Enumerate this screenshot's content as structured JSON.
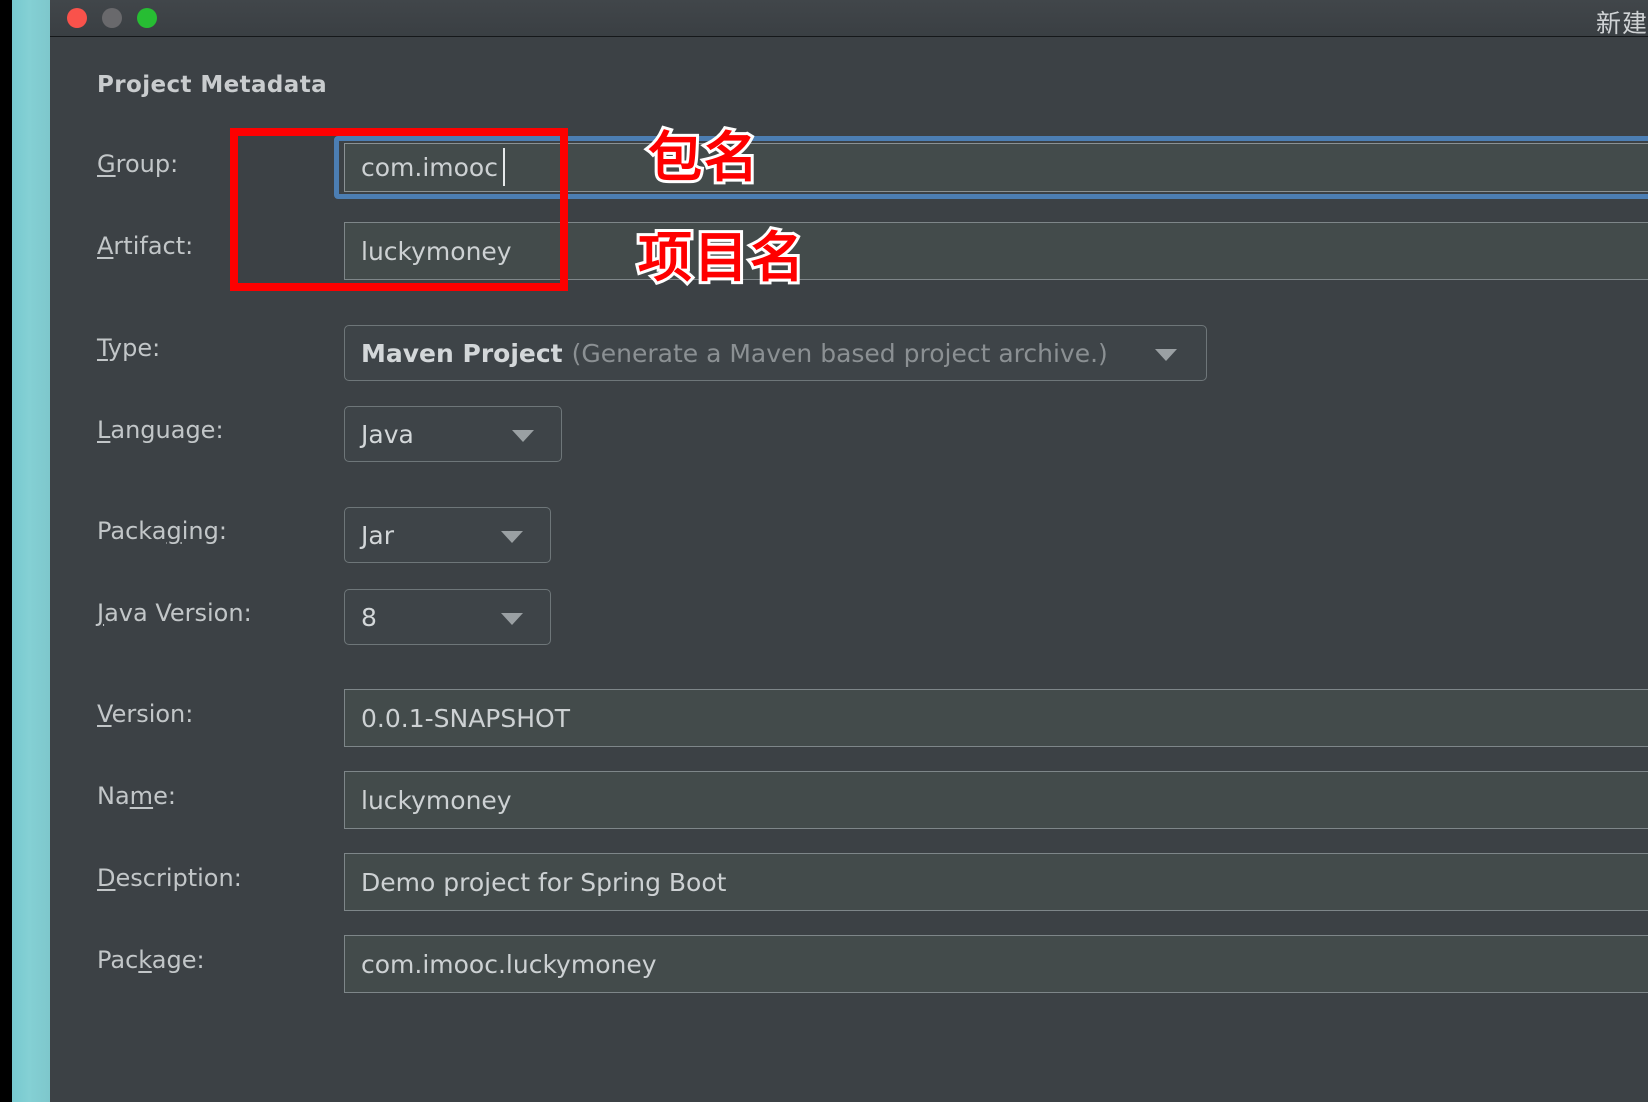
{
  "window": {
    "title": "新建",
    "traffic_lights": [
      "close",
      "minimize",
      "zoom"
    ]
  },
  "section": {
    "heading": "Project Metadata"
  },
  "form": {
    "group": {
      "label_pre": "G",
      "label_post": "roup:",
      "value": "com.imooc",
      "focused": true
    },
    "artifact": {
      "label_pre": "A",
      "label_post": "rtifact:",
      "value": "luckymoney"
    },
    "type": {
      "label_pre": "T",
      "label_post": "ype:",
      "value": "Maven Project",
      "hint": "(Generate a Maven based project archive.)"
    },
    "language": {
      "label_a": "L",
      "label_pre": "",
      "label_post": "anguage:",
      "value": "Java"
    },
    "packaging": {
      "label_a": "Packa",
      "label_b": "g",
      "label_c": "ing:",
      "value": "Jar"
    },
    "java_version": {
      "label_a": "J",
      "label_b": "ava Version:",
      "value": "8"
    },
    "version": {
      "label_a": "V",
      "label_b": "ersion:",
      "value": "0.0.1-SNAPSHOT"
    },
    "name": {
      "label_a": "Na",
      "label_b": "m",
      "label_c": "e:",
      "value": "luckymoney"
    },
    "description": {
      "label_a": "D",
      "label_b": "escription:",
      "value": "Demo project for Spring Boot"
    },
    "package": {
      "label_a": "Pac",
      "label_b": "k",
      "label_c": "age:",
      "value": "com.imooc.luckymoney"
    }
  },
  "annotations": {
    "package_name": "包名",
    "project_name": "项目名",
    "box_color": "#fe0000"
  },
  "colors": {
    "panel_bg": "#3c4145",
    "field_bg": "#434b4b",
    "accent_focus": "#4c7eb3",
    "sidebar_teal": "#84d0d4",
    "annotation_red": "#fe0000"
  }
}
